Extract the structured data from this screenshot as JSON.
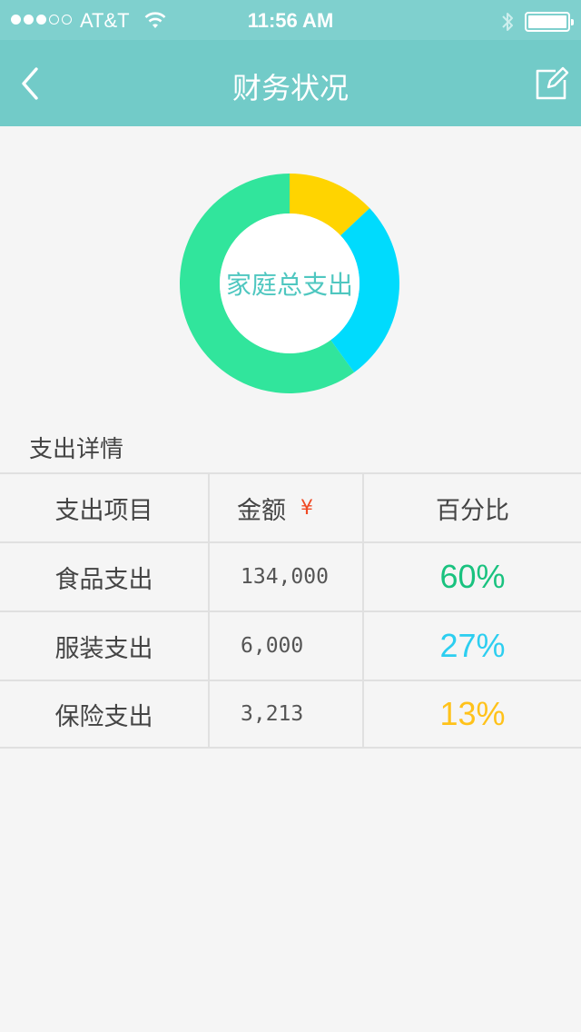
{
  "status_bar": {
    "carrier": "AT&T",
    "time": "11:56 AM",
    "signal_bars_filled": 3,
    "signal_bars_total": 5
  },
  "nav": {
    "title": "财务状况"
  },
  "chart_data": {
    "type": "pie",
    "donut": true,
    "center_label": "家庭总支出",
    "start_angle_deg": 0,
    "slices": [
      {
        "name": "保险支出",
        "percent": 13,
        "color": "#ffd400"
      },
      {
        "name": "服装支出",
        "percent": 27,
        "color": "#00dbfd"
      },
      {
        "name": "食品支出",
        "percent": 60,
        "color": "#31e59c"
      }
    ]
  },
  "details": {
    "title": "支出详情",
    "headers": {
      "item": "支出项目",
      "amount": "金额",
      "currency_symbol": "¥",
      "percent": "百分比"
    },
    "rows": [
      {
        "item": "食品支出",
        "amount": "134,000",
        "percent": "60%",
        "color": "#19c27f"
      },
      {
        "item": "服装支出",
        "amount": "6,000",
        "percent": "27%",
        "color": "#2ccef0"
      },
      {
        "item": "保险支出",
        "amount": "3,213",
        "percent": "13%",
        "color": "#ffc21a"
      }
    ]
  }
}
